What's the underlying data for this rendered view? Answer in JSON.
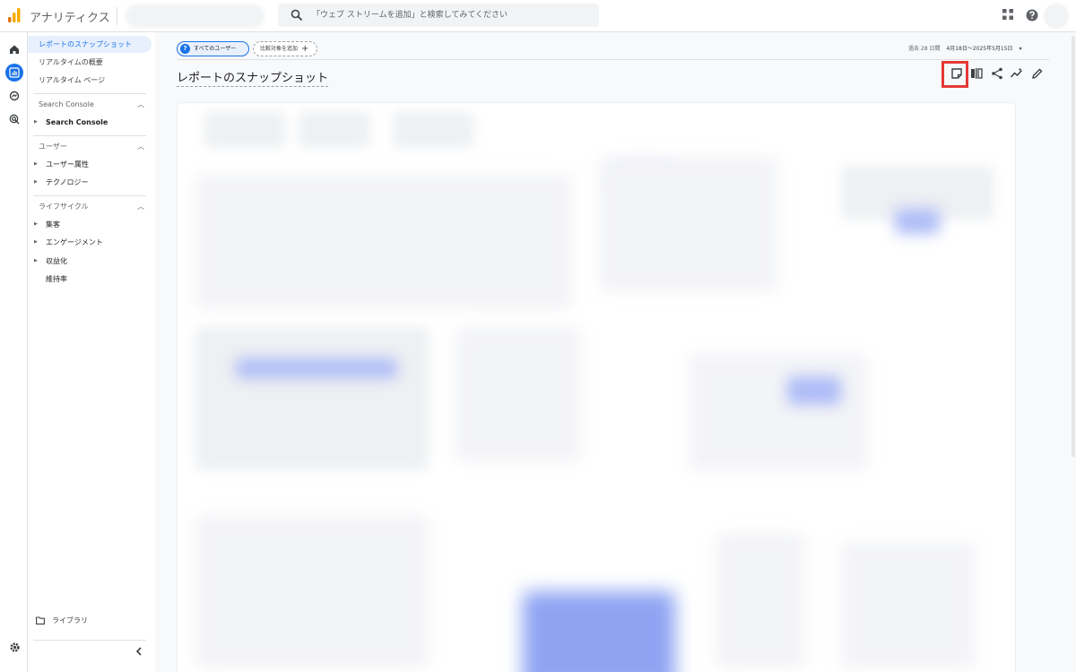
{
  "app": {
    "title": "アナリティクス"
  },
  "search": {
    "placeholder": "「ウェブ ストリームを追加」と検索してみてください"
  },
  "sidebar": {
    "top_items": [
      {
        "label": "レポートのスナップショット",
        "active": true
      },
      {
        "label": "リアルタイムの概要"
      },
      {
        "label": "リアルタイム ページ"
      }
    ],
    "sections": [
      {
        "title": "Search Console",
        "items": [
          "Search Console"
        ]
      },
      {
        "title": "ユーザー",
        "items": [
          "ユーザー属性",
          "テクノロジー"
        ]
      },
      {
        "title": "ライフサイクル",
        "items": [
          "集客",
          "エンゲージメント",
          "収益化",
          "維持率"
        ]
      }
    ],
    "library_label": "ライブラリ"
  },
  "toolbar": {
    "segment_chip": "すべてのユーザー",
    "segment_badge": "?",
    "compare_chip": "比較対象を追加",
    "compare_plus": "+",
    "date_prefix": "過去 28 日間",
    "date_range": "4月18日～2025年5月15日",
    "date_caret": "▾"
  },
  "page": {
    "title": "レポートのスナップショット"
  },
  "colors": {
    "accent": "#1a73e8",
    "highlight": "#e53935"
  }
}
